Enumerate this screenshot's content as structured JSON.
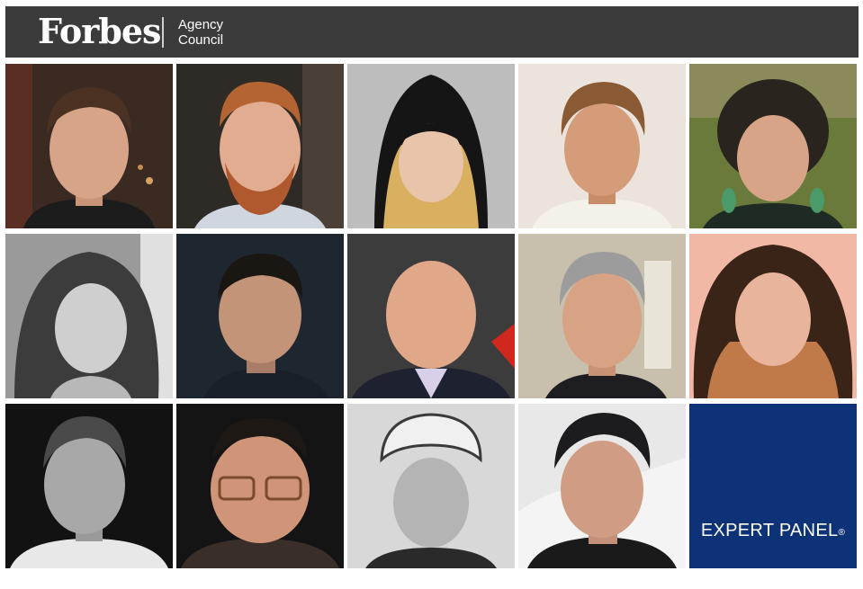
{
  "header": {
    "brand": "Forbes",
    "council_line1": "Agency",
    "council_line2": "Council"
  },
  "grid": {
    "rows": 3,
    "cols": 5,
    "portrait_count": 14
  },
  "panel": {
    "label": "EXPERT PANEL",
    "registered_mark": "®",
    "background_color": "#0d3278"
  },
  "colors": {
    "header_bg": "#3b3b3b",
    "page_bg": "#ffffff"
  }
}
